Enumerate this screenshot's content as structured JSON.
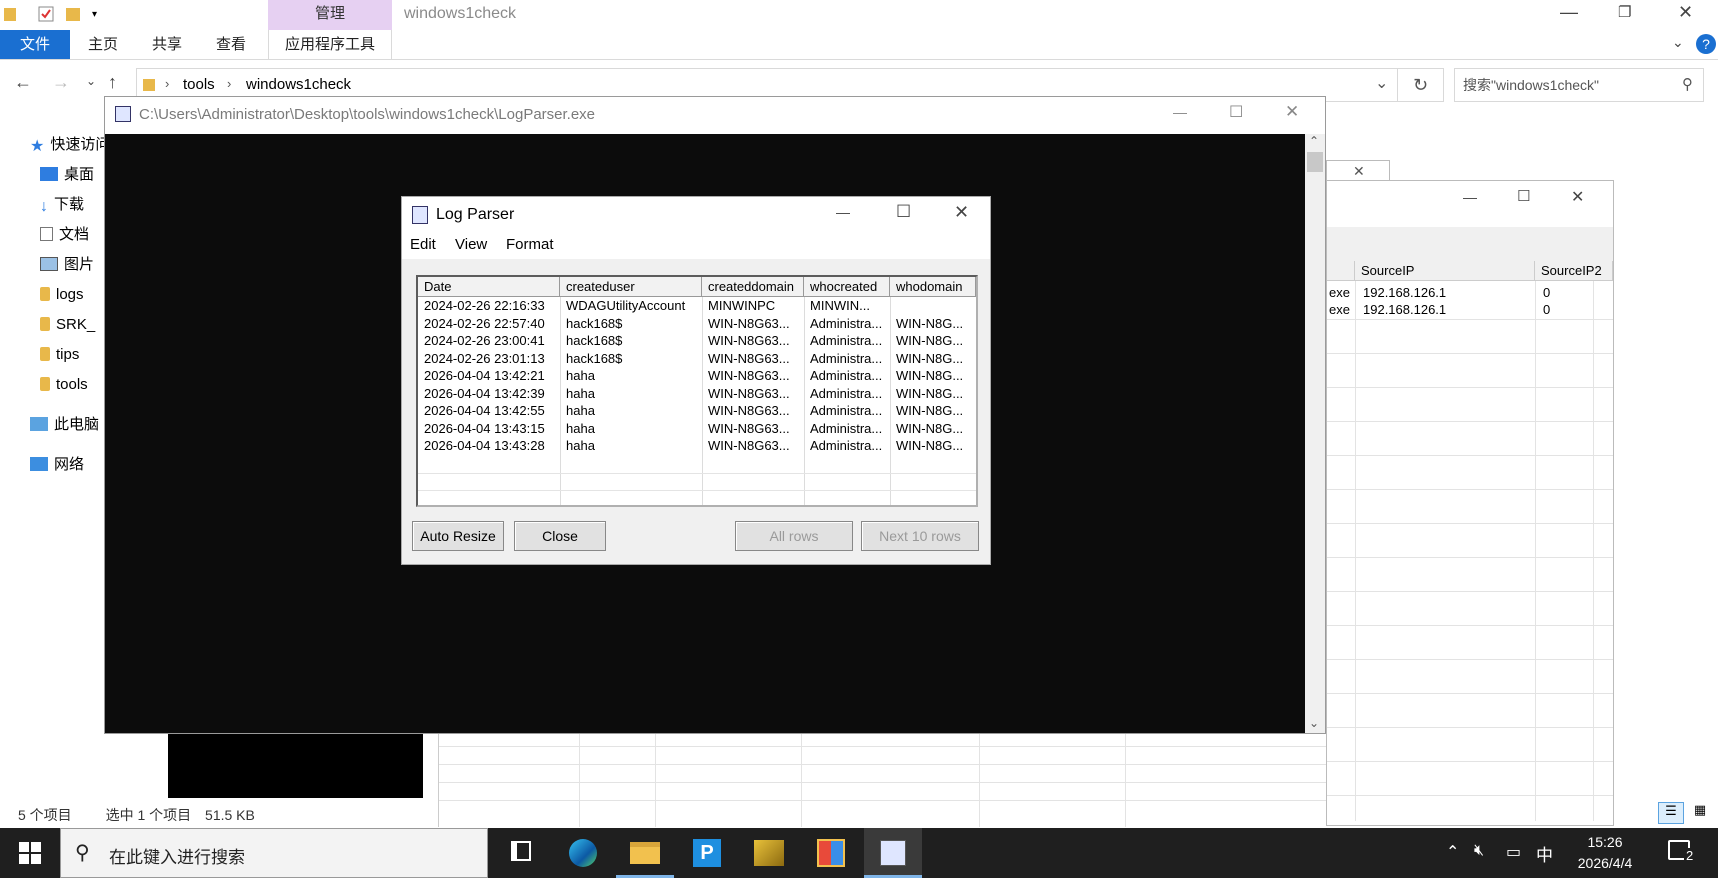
{
  "explorer": {
    "title": "windows1check",
    "tabs": {
      "file": "文件",
      "home": "主页",
      "share": "共享",
      "view": "查看",
      "manage": "管理",
      "app_tools": "应用程序工具"
    },
    "breadcrumb": [
      "tools",
      "windows1check"
    ],
    "search_placeholder": "搜索\"windows1check\"",
    "nav": {
      "quick_access": "快速访问",
      "desktop": "桌面",
      "downloads": "下载",
      "documents": "文档",
      "pictures": "图片",
      "logs": "logs",
      "srk": "SRK_",
      "tips": "tips",
      "tools": "tools",
      "this_pc": "此电脑",
      "network": "网络"
    },
    "status": {
      "count": "5 个项目",
      "selected": "选中 1 个项目",
      "size": "51.5 KB"
    }
  },
  "bg_window": {
    "headers": [
      "SourceIP",
      "SourceIP2"
    ],
    "rows": [
      {
        "prefix": "exe",
        "ip": "192.168.126.1",
        "val": "0"
      },
      {
        "prefix": "exe",
        "ip": "192.168.126.1",
        "val": "0"
      }
    ]
  },
  "console": {
    "title": "C:\\Users\\Administrator\\Desktop\\tools\\windows1check\\LogParser.exe"
  },
  "log_parser": {
    "title": "Log Parser",
    "menu": [
      "Edit",
      "View",
      "Format"
    ],
    "columns": [
      "Date",
      "createduser",
      "createddomain",
      "whocreated",
      "whodomain"
    ],
    "rows": [
      [
        "2024-02-26 22:16:33",
        "WDAGUtilityAccount",
        "MINWINPC",
        "MINWIN...",
        ""
      ],
      [
        "2024-02-26 22:57:40",
        "hack168$",
        "WIN-N8G63...",
        "Administra...",
        "WIN-N8G..."
      ],
      [
        "2024-02-26 23:00:41",
        "hack168$",
        "WIN-N8G63...",
        "Administra...",
        "WIN-N8G..."
      ],
      [
        "2024-02-26 23:01:13",
        "hack168$",
        "WIN-N8G63...",
        "Administra...",
        "WIN-N8G..."
      ],
      [
        "2026-04-04 13:42:21",
        "haha",
        "WIN-N8G63...",
        "Administra...",
        "WIN-N8G..."
      ],
      [
        "2026-04-04 13:42:39",
        "haha",
        "WIN-N8G63...",
        "Administra...",
        "WIN-N8G..."
      ],
      [
        "2026-04-04 13:42:55",
        "haha",
        "WIN-N8G63...",
        "Administra...",
        "WIN-N8G..."
      ],
      [
        "2026-04-04 13:43:15",
        "haha",
        "WIN-N8G63...",
        "Administra...",
        "WIN-N8G..."
      ],
      [
        "2026-04-04 13:43:28",
        "haha",
        "WIN-N8G63...",
        "Administra...",
        "WIN-N8G..."
      ]
    ],
    "buttons": {
      "auto_resize": "Auto Resize",
      "close": "Close",
      "all_rows": "All rows",
      "next_rows": "Next 10 rows"
    }
  },
  "taskbar": {
    "search_placeholder": "在此键入进行搜索",
    "ime": "中",
    "time": "15:26",
    "date": "2026/4/4",
    "notifications": "2"
  }
}
